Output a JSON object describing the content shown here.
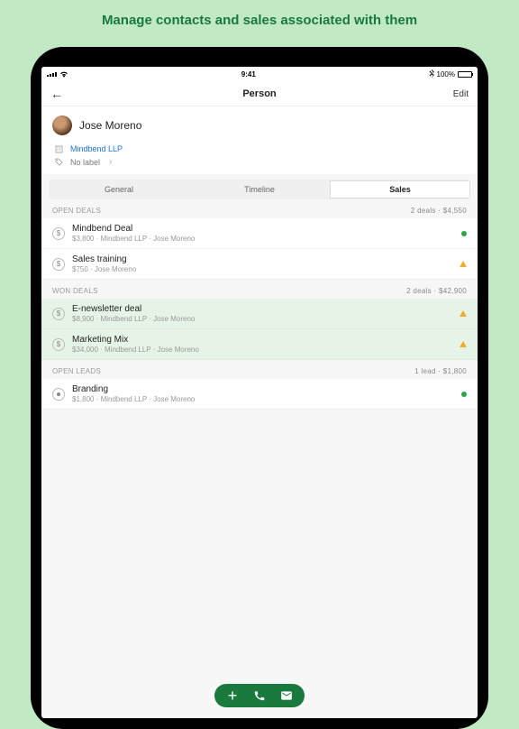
{
  "promo": "Manage contacts and sales associated with them",
  "status": {
    "time": "9:41",
    "battery": "100%"
  },
  "nav": {
    "title": "Person",
    "edit": "Edit"
  },
  "person": {
    "name": "Jose Moreno",
    "company": "Mindbend LLP",
    "label": "No label"
  },
  "tabs": {
    "general": "General",
    "timeline": "Timeline",
    "sales": "Sales"
  },
  "sections": {
    "open_deals": {
      "title": "OPEN DEALS",
      "summary": "2 deals · $4,550"
    },
    "won_deals": {
      "title": "WON DEALS",
      "summary": "2 deals · $42,900"
    },
    "open_leads": {
      "title": "OPEN LEADS",
      "summary": "1 lead · $1,800"
    }
  },
  "deals": {
    "open": [
      {
        "title": "Mindbend Deal",
        "meta": "$3,800 · Mindbend LLP · Jose Moreno"
      },
      {
        "title": "Sales training",
        "meta": "$750 · Jose Moreno"
      }
    ],
    "won": [
      {
        "title": "E-newsletter deal",
        "meta": "$8,900 · Mindbend LLP · Jose Moreno"
      },
      {
        "title": "Marketing Mix",
        "meta": "$34,000 · Mindbend LLP · Jose Moreno"
      }
    ],
    "leads": [
      {
        "title": "Branding",
        "meta": "$1,800 · Mindbend LLP · Jose Moreno"
      }
    ]
  }
}
